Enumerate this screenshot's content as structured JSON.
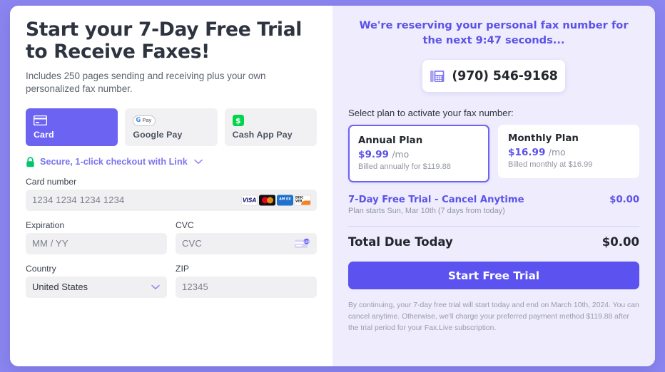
{
  "left": {
    "headline_line1": "Start your 7-Day Free Trial",
    "headline_line2": "to Receive Faxes!",
    "subhead": "Includes 250 pages sending and receiving plus your own personalized fax number.",
    "payment_methods": [
      {
        "label": "Card",
        "icon": "credit-card-icon",
        "selected": true
      },
      {
        "label": "Google Pay",
        "icon": "google-pay-icon",
        "selected": false
      },
      {
        "label": "Cash App Pay",
        "icon": "cash-app-icon",
        "selected": false
      }
    ],
    "gpay": {
      "g": "G",
      "pay": "Pay"
    },
    "cashapp_glyph": "$",
    "link_row": {
      "icon": "green-lock-icon",
      "text": "Secure, 1-click checkout with Link",
      "chevron": "chevron-down-icon"
    },
    "fields": {
      "card_number_label": "Card number",
      "card_number_placeholder": "1234 1234 1234 1234",
      "expiration_label": "Expiration",
      "expiration_placeholder": "MM / YY",
      "cvc_label": "CVC",
      "cvc_placeholder": "CVC",
      "country_label": "Country",
      "country_value": "United States",
      "zip_label": "ZIP",
      "zip_placeholder": "12345"
    },
    "card_brands": [
      {
        "name": "visa",
        "text": "VISA"
      },
      {
        "name": "mastercard",
        "text": ""
      },
      {
        "name": "amex",
        "text": "AM EX"
      },
      {
        "name": "discover",
        "text": "DISC VER"
      }
    ]
  },
  "right": {
    "reserve_text": "We're reserving your personal fax number for the next 9:47 seconds...",
    "countdown": "9:47",
    "fax_icon": "fax-machine-icon",
    "fax_number": "(970) 546-9168",
    "select_plan_label": "Select plan to activate your fax number:",
    "plans": [
      {
        "name": "Annual Plan",
        "price": "$9.99",
        "period": "/mo",
        "billed": "Billed annually for $119.88",
        "selected": true
      },
      {
        "name": "Monthly Plan",
        "price": "$16.99",
        "period": "/mo",
        "billed": "Billed monthly at $16.99",
        "selected": false
      }
    ],
    "trial_title": "7-Day Free Trial - Cancel Anytime",
    "trial_amount": "$0.00",
    "trial_sub": "Plan starts Sun, Mar 10th (7 days from today)",
    "total_label": "Total Due Today",
    "total_amount": "$0.00",
    "cta_label": "Start Free Trial",
    "fine_print": "By continuing, your 7-day free trial will start today and end on March 10th, 2024. You can cancel anytime. Otherwise, we'll charge your preferred payment method $119.88 after the trial period for your Fax.Live subscription."
  },
  "colors": {
    "brand_purple": "#5b52ef",
    "tab_selected": "#6c63f3",
    "page_background": "#8b85f0",
    "summary_background": "#eeecfd",
    "link_green": "#00c66b"
  }
}
